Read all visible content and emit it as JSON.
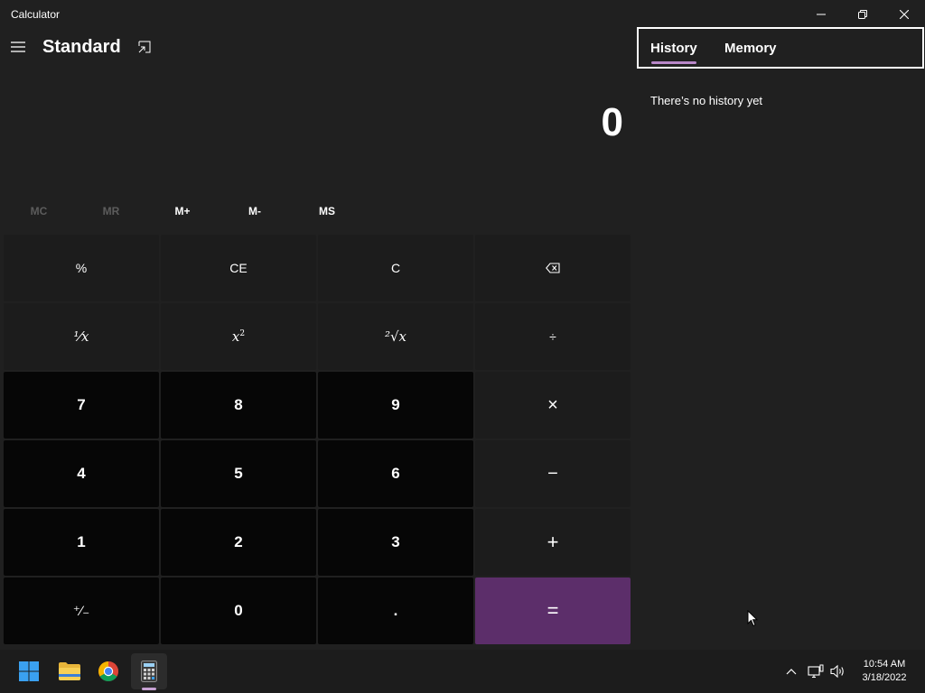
{
  "window": {
    "title": "Calculator"
  },
  "header": {
    "mode_title": "Standard"
  },
  "display": {
    "value": "0"
  },
  "memory_row": {
    "mc": "MC",
    "mr": "MR",
    "m_plus": "M+",
    "m_minus": "M-",
    "ms": "MS"
  },
  "keys": {
    "percent": "%",
    "ce": "CE",
    "c": "C",
    "reciprocal": "¹⁄x",
    "square": "x",
    "square_sup": "2",
    "sqrt": "²√x",
    "divide": "÷",
    "seven": "7",
    "eight": "8",
    "nine": "9",
    "multiply": "×",
    "four": "4",
    "five": "5",
    "six": "6",
    "minus": "−",
    "one": "1",
    "two": "2",
    "three": "3",
    "plus": "+",
    "negate": "⁺∕₋",
    "zero": "0",
    "decimal": ".",
    "equals": "="
  },
  "history_pane": {
    "tab_history": "History",
    "tab_memory": "Memory",
    "empty_message": "There’s no history yet"
  },
  "taskbar": {
    "apps": [
      "start-icon",
      "file-explorer-icon",
      "chrome-icon",
      "calculator-icon"
    ],
    "time": "10:54 AM",
    "date": "3/18/2022"
  },
  "colors": {
    "background": "#202020",
    "operator_key": "#1c1c1c",
    "number_key": "#060606",
    "equals_key": "#5c2e6a",
    "accent": "#b887c8"
  }
}
